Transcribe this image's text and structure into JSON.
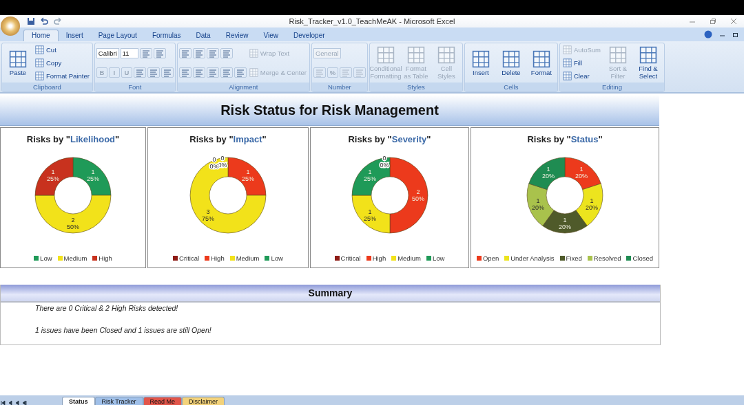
{
  "window": {
    "title": "Risk_Tracker_v1.0_TeachMeAK - Microsoft Excel"
  },
  "ribbon_tabs": [
    {
      "label": "Home",
      "selected": true
    },
    {
      "label": "Insert",
      "selected": false
    },
    {
      "label": "Page Layout",
      "selected": false
    },
    {
      "label": "Formulas",
      "selected": false
    },
    {
      "label": "Data",
      "selected": false
    },
    {
      "label": "Review",
      "selected": false
    },
    {
      "label": "View",
      "selected": false
    },
    {
      "label": "Developer",
      "selected": false
    }
  ],
  "ribbon_groups": [
    {
      "label": "Clipboard",
      "cols": [
        [
          [
            {
              "kind": "large",
              "label": "Paste",
              "disabled": false
            }
          ]
        ],
        [
          [
            {
              "kind": "small",
              "label": "Cut",
              "disabled": false
            }
          ],
          [
            {
              "kind": "small",
              "label": "Copy",
              "disabled": false
            }
          ],
          [
            {
              "kind": "small",
              "label": "Format Painter",
              "disabled": false
            }
          ]
        ]
      ]
    },
    {
      "label": "Font",
      "cols": [
        [
          [
            {
              "kind": "combo",
              "label": "Calibri",
              "disabled": false
            },
            {
              "kind": "combo",
              "label": "11",
              "disabled": false
            },
            {
              "kind": "tool",
              "disabled": false
            },
            {
              "kind": "tool",
              "disabled": false
            }
          ],
          [
            {
              "kind": "text",
              "label": "B",
              "disabled": true
            },
            {
              "kind": "text",
              "label": "I",
              "disabled": true
            },
            {
              "kind": "text",
              "label": "U",
              "disabled": true
            },
            {
              "kind": "tool",
              "disabled": false
            },
            {
              "kind": "tool",
              "disabled": false
            },
            {
              "kind": "tool",
              "disabled": false
            }
          ]
        ]
      ]
    },
    {
      "label": "Alignment",
      "cols": [
        [
          [
            {
              "kind": "tool",
              "disabled": false
            },
            {
              "kind": "tool",
              "disabled": false
            },
            {
              "kind": "tool",
              "disabled": false
            },
            {
              "kind": "tool",
              "disabled": false
            }
          ],
          [
            {
              "kind": "tool",
              "disabled": false
            },
            {
              "kind": "tool",
              "disabled": false
            },
            {
              "kind": "tool",
              "disabled": false
            },
            {
              "kind": "tool",
              "disabled": false
            },
            {
              "kind": "tool",
              "disabled": false
            }
          ]
        ],
        [
          [
            {
              "kind": "small",
              "label": "Wrap Text",
              "disabled": true
            }
          ],
          [
            {
              "kind": "small",
              "label": "Merge & Center",
              "disabled": true
            }
          ]
        ]
      ]
    },
    {
      "label": "Number",
      "cols": [
        [
          [
            {
              "kind": "combo",
              "label": "General",
              "disabled": true
            }
          ],
          [
            {
              "kind": "tool",
              "disabled": true
            },
            {
              "kind": "text",
              "label": "%",
              "disabled": true
            },
            {
              "kind": "tool",
              "disabled": true
            },
            {
              "kind": "tool",
              "disabled": true
            }
          ]
        ]
      ]
    },
    {
      "label": "Styles",
      "cols": [
        [
          [
            {
              "kind": "large",
              "label": "Conditional Formatting",
              "disabled": true
            }
          ]
        ],
        [
          [
            {
              "kind": "large",
              "label": "Format as Table",
              "disabled": true
            }
          ]
        ],
        [
          [
            {
              "kind": "large",
              "label": "Cell Styles",
              "disabled": true
            }
          ]
        ]
      ]
    },
    {
      "label": "Cells",
      "cols": [
        [
          [
            {
              "kind": "large",
              "label": "Insert",
              "disabled": false
            }
          ]
        ],
        [
          [
            {
              "kind": "large",
              "label": "Delete",
              "disabled": false
            }
          ]
        ],
        [
          [
            {
              "kind": "large",
              "label": "Format",
              "disabled": false
            }
          ]
        ]
      ]
    },
    {
      "label": "Editing",
      "cols": [
        [
          [
            {
              "kind": "small",
              "label": "AutoSum",
              "disabled": true
            }
          ],
          [
            {
              "kind": "small",
              "label": "Fill",
              "disabled": false
            }
          ],
          [
            {
              "kind": "small",
              "label": "Clear",
              "disabled": false
            }
          ]
        ],
        [
          [
            {
              "kind": "large",
              "label": "Sort & Filter",
              "disabled": true
            }
          ]
        ],
        [
          [
            {
              "kind": "large",
              "label": "Find & Select",
              "disabled": false
            }
          ]
        ]
      ]
    }
  ],
  "sheet": {
    "title": "Risk Status for Risk Management",
    "charts": [
      {
        "heading": {
          "lead": "Risks by \"",
          "field": "Likelihood",
          "trail": "\""
        },
        "chart_data": {
          "type": "donut",
          "categories": [
            "Low",
            "Medium",
            "High"
          ],
          "values": [
            25,
            50,
            25
          ],
          "colors": [
            "#1f9a58",
            "#f2e21a",
            "#c8321e"
          ],
          "data_labels": true,
          "value_labels": [
            [
              "1",
              "25%"
            ],
            [
              "2",
              "50%"
            ],
            [
              "1",
              "25%"
            ]
          ]
        }
      },
      {
        "heading": {
          "lead": "Risks by \"",
          "field": "Impact",
          "trail": "\""
        },
        "chart_data": {
          "type": "donut",
          "categories": [
            "Critical",
            "High",
            "Medium",
            "Low"
          ],
          "values": [
            0,
            25,
            75,
            0
          ],
          "colors": [
            "#8e1c16",
            "#ec3a1c",
            "#f2e21a",
            "#1f9a58"
          ],
          "data_labels": true,
          "value_labels": [
            [
              "0",
              "0%"
            ],
            [
              "1",
              "25%"
            ],
            [
              "3",
              "75%"
            ],
            [
              "0",
              "0%"
            ]
          ]
        }
      },
      {
        "heading": {
          "lead": "Risks by \"",
          "field": "Severity",
          "trail": "\""
        },
        "chart_data": {
          "type": "donut",
          "categories": [
            "Critical",
            "High",
            "Medium",
            "Low"
          ],
          "values": [
            0,
            50,
            25,
            25
          ],
          "colors": [
            "#8e1c16",
            "#ec3a1c",
            "#f2e21a",
            "#1f9a58"
          ],
          "data_labels": true,
          "value_labels": [
            [
              "0",
              "0%"
            ],
            [
              "2",
              "50%"
            ],
            [
              "1",
              "25%"
            ],
            [
              "1",
              "25%"
            ]
          ]
        }
      },
      {
        "heading": {
          "lead": "Risks by \"",
          "field": "Status",
          "trail": "\""
        },
        "chart_data": {
          "type": "donut",
          "categories": [
            "Open",
            "Under Analysis",
            "Fixed",
            "Resolved",
            "Closed"
          ],
          "values": [
            20,
            20,
            20,
            20,
            20
          ],
          "colors": [
            "#ec3a1c",
            "#ece41e",
            "#4f5a2a",
            "#a9c24c",
            "#1f8c52"
          ],
          "data_labels": true,
          "value_labels": [
            [
              "1",
              "20%"
            ],
            [
              "1",
              "20%"
            ],
            [
              "1",
              "20%"
            ],
            [
              "1",
              "20%"
            ],
            [
              "1",
              "20%"
            ]
          ]
        }
      }
    ],
    "summary": {
      "title": "Summary",
      "lines": [
        "There are 0 Critical & 2 High Risks detected!",
        "1 issues have been Closed and 1 issues are still Open!"
      ]
    }
  },
  "sheet_tabs": [
    {
      "label": "Status",
      "color": "#ffffff",
      "selected": true
    },
    {
      "label": "Risk Tracker",
      "color": "#9fbfe8",
      "selected": false
    },
    {
      "label": "Read Me",
      "color": "#e2554a",
      "selected": false
    },
    {
      "label": "Disclaimer",
      "color": "#f3d27a",
      "selected": false
    }
  ]
}
